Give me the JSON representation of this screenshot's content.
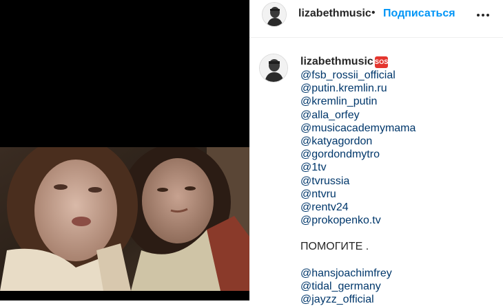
{
  "post": {
    "username": "lizabethmusic",
    "separator": "•",
    "follow_label": "Подписаться",
    "more_icon": "more-options-icon"
  },
  "caption": {
    "username": "lizabethmusic",
    "emoji_badge": "SOS",
    "lines": [
      {
        "text": "@fsb_rossii_official",
        "kind": "mention"
      },
      {
        "text": "@putin.kremlin.ru",
        "kind": "mention"
      },
      {
        "text": "@kremlin_putin",
        "kind": "mention"
      },
      {
        "text": "@alla_orfey",
        "kind": "mention"
      },
      {
        "text": "@musicacademymama",
        "kind": "mention"
      },
      {
        "text": "@katyagordon",
        "kind": "mention"
      },
      {
        "text": "@gordondmytro",
        "kind": "mention"
      },
      {
        "text": "@1tv",
        "kind": "mention"
      },
      {
        "text": "@tvrussia",
        "kind": "mention"
      },
      {
        "text": "@ntvru",
        "kind": "mention"
      },
      {
        "text": "@rentv24",
        "kind": "mention"
      },
      {
        "text": "@prokopenko.tv",
        "kind": "mention"
      },
      {
        "text": "",
        "kind": "blank"
      },
      {
        "text": "ПОМОГИТЕ .",
        "kind": "plain"
      },
      {
        "text": "",
        "kind": "blank"
      },
      {
        "text": "@hansjoachimfrey",
        "kind": "mention"
      },
      {
        "text": "@tidal_germany",
        "kind": "mention"
      },
      {
        "text": "@jayzz_official",
        "kind": "mention"
      }
    ]
  },
  "colors": {
    "link": "#00376b",
    "follow": "#0095f6",
    "sos_badge": "#e4352e",
    "media_background": "#000000"
  }
}
